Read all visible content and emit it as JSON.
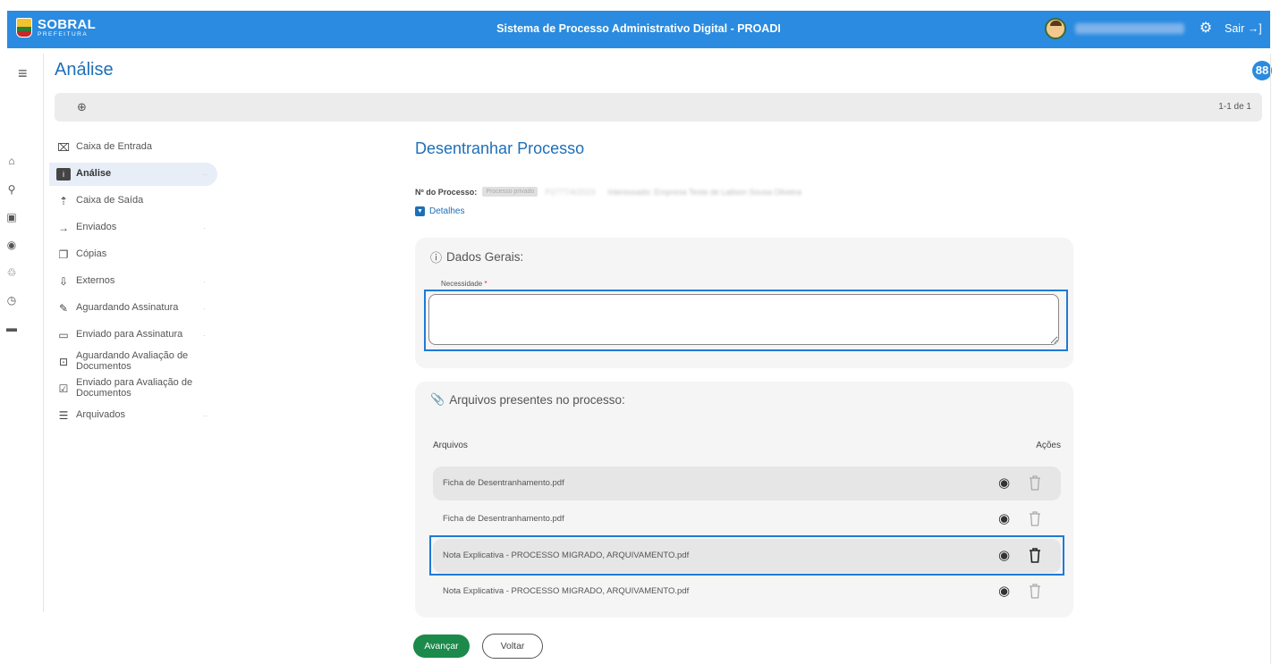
{
  "header": {
    "brand": "SOBRAL",
    "brand_sub": "PREFEITURA",
    "system_title": "Sistema de Processo Administrativo Digital - PROADI",
    "logout_label": "Sair",
    "logout_icon": "→]"
  },
  "page": {
    "title": "Análise",
    "menu_icon": "≡",
    "apps_icon": "88"
  },
  "search": {
    "icon": "⊕",
    "pagination": "1-1 de 1"
  },
  "rail": [
    "⌂",
    "⚲",
    "▣",
    "◉",
    "♲",
    "◷",
    "▬"
  ],
  "sidebar": {
    "items": [
      {
        "label": "Caixa de Entrada",
        "icon": "⌧",
        "count": ""
      },
      {
        "label": "Análise",
        "icon": "i",
        "count": "··"
      },
      {
        "label": "Caixa de Saída",
        "icon": "⇡",
        "count": ""
      },
      {
        "label": "Enviados",
        "icon": "→",
        "count": "·"
      },
      {
        "label": "Cópias",
        "icon": "❐",
        "count": ""
      },
      {
        "label": "Externos",
        "icon": "⇩",
        "count": "·"
      },
      {
        "label": "Aguardando Assinatura",
        "icon": "✎",
        "count": "·"
      },
      {
        "label": "Enviado para Assinatura",
        "icon": "▭",
        "count": "·"
      },
      {
        "label": "Aguardando Avaliação de Documentos",
        "icon": "⊡",
        "count": ""
      },
      {
        "label": "Enviado para Avaliação de Documentos",
        "icon": "☑",
        "count": ""
      },
      {
        "label": "Arquivados",
        "icon": "☰",
        "count": "··"
      }
    ]
  },
  "form": {
    "title": "Desentranhar Processo",
    "process_label": "Nº do Processo:",
    "process_badge": "Processo privado",
    "process_number": "P2777/4/2023",
    "interested": "Interessado: Empresa Teste de Lailson Sousa Oliveira",
    "details_label": "Detalhes",
    "general": {
      "title": "Dados Gerais:",
      "field_label": "Necessidade",
      "field_required": "*",
      "field_value": ""
    },
    "files": {
      "title": "Arquivos presentes no processo:",
      "col_files": "Arquivos",
      "col_actions": "Ações",
      "rows": [
        {
          "name": "Ficha de Desentranhamento.pdf"
        },
        {
          "name": "Ficha de Desentranhamento.pdf"
        },
        {
          "name": "Nota Explicativa - PROCESSO MIGRADO, ARQUIVAMENTO.pdf"
        },
        {
          "name": "Nota Explicativa - PROCESSO MIGRADO, ARQUIVAMENTO.pdf"
        }
      ]
    }
  },
  "actions": {
    "next": "Avançar",
    "back": "Voltar"
  },
  "colors": {
    "topbar": "#2a8be0",
    "accent": "#1e6fb8",
    "highlight": "#1f7ad6",
    "primary_button": "#1b8a4a"
  }
}
